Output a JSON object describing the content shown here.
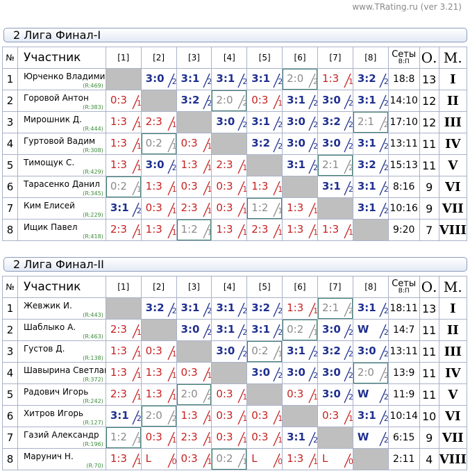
{
  "version": "www.TRating.ru (ver 3.21)",
  "headers": {
    "no": "№",
    "name": "Участник",
    "cols": [
      "[1]",
      "[2]",
      "[3]",
      "[4]",
      "[5]",
      "[6]",
      "[7]",
      "[8]"
    ],
    "sets": "Сеты",
    "sets_sub": "В:П",
    "points": "О.",
    "place": "М."
  },
  "tables": [
    {
      "title": "2 Лига Финал-I",
      "rows": [
        {
          "no": "1",
          "name": "Юрченко Владимир",
          "rating": "(R:469)",
          "results": [
            null,
            [
              "3:0",
              "2",
              "w"
            ],
            [
              "3:1",
              "2",
              "w"
            ],
            [
              "3:1",
              "2",
              "w"
            ],
            [
              "3:1",
              "2",
              "w"
            ],
            [
              "2:0",
              "2",
              "d"
            ],
            [
              "1:3",
              "1",
              "l"
            ],
            [
              "3:2",
              "2",
              "w"
            ]
          ],
          "sets": "18:8",
          "points": "13",
          "place": "I"
        },
        {
          "no": "2",
          "name": "Горовой Антон",
          "rating": "(R:383)",
          "results": [
            [
              "0:3",
              "1",
              "l"
            ],
            null,
            [
              "3:2",
              "2",
              "w"
            ],
            [
              "2:0",
              "2",
              "d"
            ],
            [
              "0:3",
              "1",
              "l"
            ],
            [
              "3:1",
              "2",
              "w"
            ],
            [
              "3:0",
              "2",
              "w"
            ],
            [
              "3:1",
              "2",
              "w"
            ]
          ],
          "sets": "14:10",
          "points": "12",
          "place": "II"
        },
        {
          "no": "3",
          "name": "Мирошник Д.",
          "rating": "(R:444)",
          "results": [
            [
              "1:3",
              "1",
              "l"
            ],
            [
              "2:3",
              "1",
              "l"
            ],
            null,
            [
              "3:0",
              "2",
              "w"
            ],
            [
              "3:1",
              "2",
              "w"
            ],
            [
              "3:0",
              "2",
              "w"
            ],
            [
              "3:2",
              "2",
              "w"
            ],
            [
              "2:1",
              "2",
              "d"
            ]
          ],
          "sets": "17:10",
          "points": "12",
          "place": "III"
        },
        {
          "no": "4",
          "name": "Гуртовой Вадим",
          "rating": "(R:308)",
          "results": [
            [
              "1:3",
              "1",
              "l"
            ],
            [
              "0:2",
              "1",
              "d"
            ],
            [
              "0:3",
              "1",
              "l"
            ],
            null,
            [
              "3:2",
              "2",
              "w"
            ],
            [
              "3:0",
              "2",
              "w"
            ],
            [
              "3:0",
              "2",
              "w"
            ],
            [
              "3:1",
              "2",
              "w"
            ]
          ],
          "sets": "13:11",
          "points": "11",
          "place": "IV"
        },
        {
          "no": "5",
          "name": "Тимощук С.",
          "rating": "(R:429)",
          "results": [
            [
              "1:3",
              "1",
              "l"
            ],
            [
              "3:0",
              "2",
              "w"
            ],
            [
              "1:3",
              "1",
              "l"
            ],
            [
              "2:3",
              "1",
              "l"
            ],
            null,
            [
              "3:1",
              "2",
              "w"
            ],
            [
              "2:1",
              "2",
              "d"
            ],
            [
              "3:2",
              "2",
              "w"
            ]
          ],
          "sets": "15:13",
          "points": "11",
          "place": "V"
        },
        {
          "no": "6",
          "name": "Тарасенко Данил",
          "rating": "(R:345)",
          "results": [
            [
              "0:2",
              "1",
              "d"
            ],
            [
              "1:3",
              "1",
              "l"
            ],
            [
              "0:3",
              "1",
              "l"
            ],
            [
              "0:3",
              "1",
              "l"
            ],
            [
              "1:3",
              "1",
              "l"
            ],
            null,
            [
              "3:1",
              "2",
              "w"
            ],
            [
              "3:1",
              "2",
              "w"
            ]
          ],
          "sets": "8:16",
          "points": "9",
          "place": "VI"
        },
        {
          "no": "7",
          "name": "Ким Елисей",
          "rating": "(R:229)",
          "results": [
            [
              "3:1",
              "2",
              "w"
            ],
            [
              "0:3",
              "1",
              "l"
            ],
            [
              "2:3",
              "1",
              "l"
            ],
            [
              "0:3",
              "1",
              "l"
            ],
            [
              "1:2",
              "1",
              "d"
            ],
            [
              "1:3",
              "1",
              "l"
            ],
            null,
            [
              "3:1",
              "2",
              "w"
            ]
          ],
          "sets": "10:16",
          "points": "9",
          "place": "VII"
        },
        {
          "no": "8",
          "name": "Ищик Павел",
          "rating": "(R:418)",
          "results": [
            [
              "2:3",
              "1",
              "l"
            ],
            [
              "1:3",
              "1",
              "l"
            ],
            [
              "1:2",
              "1",
              "d"
            ],
            [
              "1:3",
              "1",
              "l"
            ],
            [
              "2:3",
              "1",
              "l"
            ],
            [
              "1:3",
              "1",
              "l"
            ],
            [
              "1:3",
              "1",
              "l"
            ],
            null
          ],
          "sets": "9:20",
          "points": "7",
          "place": "VIII"
        }
      ]
    },
    {
      "title": "2 Лига Финал-II",
      "rows": [
        {
          "no": "1",
          "name": "Жевжик И.",
          "rating": "(R:443)",
          "results": [
            null,
            [
              "3:2",
              "2",
              "w"
            ],
            [
              "3:1",
              "2",
              "w"
            ],
            [
              "3:1",
              "2",
              "w"
            ],
            [
              "3:2",
              "2",
              "w"
            ],
            [
              "1:3",
              "1",
              "l"
            ],
            [
              "2:1",
              "2",
              "d"
            ],
            [
              "3:1",
              "2",
              "w"
            ]
          ],
          "sets": "18:11",
          "points": "13",
          "place": "I"
        },
        {
          "no": "2",
          "name": "Шаблыко А.",
          "rating": "(R:463)",
          "results": [
            [
              "2:3",
              "1",
              "l"
            ],
            null,
            [
              "3:0",
              "2",
              "w"
            ],
            [
              "3:1",
              "2",
              "w"
            ],
            [
              "3:1",
              "2",
              "w"
            ],
            [
              "0:2",
              "1",
              "d"
            ],
            [
              "3:0",
              "2",
              "w"
            ],
            [
              "W",
              "2",
              "w"
            ]
          ],
          "sets": "14:7",
          "points": "11",
          "place": "II"
        },
        {
          "no": "3",
          "name": "Густов Д.",
          "rating": "(R:138)",
          "results": [
            [
              "1:3",
              "1",
              "l"
            ],
            [
              "0:3",
              "1",
              "l"
            ],
            null,
            [
              "3:0",
              "2",
              "w"
            ],
            [
              "0:2",
              "1",
              "d"
            ],
            [
              "3:1",
              "2",
              "w"
            ],
            [
              "3:2",
              "2",
              "w"
            ],
            [
              "3:0",
              "2",
              "w"
            ]
          ],
          "sets": "13:11",
          "points": "11",
          "place": "III"
        },
        {
          "no": "4",
          "name": "Шавырина Светлана",
          "rating": "(R:372)",
          "results": [
            [
              "1:3",
              "1",
              "l"
            ],
            [
              "1:3",
              "1",
              "l"
            ],
            [
              "0:3",
              "1",
              "l"
            ],
            null,
            [
              "3:0",
              "2",
              "w"
            ],
            [
              "3:0",
              "2",
              "w"
            ],
            [
              "3:0",
              "2",
              "w"
            ],
            [
              "2:0",
              "2",
              "d"
            ]
          ],
          "sets": "13:9",
          "points": "11",
          "place": "IV"
        },
        {
          "no": "5",
          "name": "Радович Игорь",
          "rating": "(R:242)",
          "results": [
            [
              "2:3",
              "1",
              "l"
            ],
            [
              "1:3",
              "1",
              "l"
            ],
            [
              "2:0",
              "2",
              "d"
            ],
            [
              "0:3",
              "1",
              "l"
            ],
            null,
            [
              "0:3",
              "1",
              "l"
            ],
            [
              "3:0",
              "2",
              "w"
            ],
            [
              "W",
              "2",
              "w"
            ]
          ],
          "sets": "11:9",
          "points": "11",
          "place": "V"
        },
        {
          "no": "6",
          "name": "Хитров Игорь",
          "rating": "(R:127)",
          "results": [
            [
              "3:1",
              "2",
              "w"
            ],
            [
              "2:0",
              "2",
              "d"
            ],
            [
              "1:3",
              "1",
              "l"
            ],
            [
              "0:3",
              "1",
              "l"
            ],
            [
              "0:3",
              "1",
              "l"
            ],
            null,
            [
              "0:3",
              "1",
              "l"
            ],
            [
              "3:1",
              "2",
              "w"
            ]
          ],
          "sets": "10:14",
          "points": "10",
          "place": "VI"
        },
        {
          "no": "7",
          "name": "Газий Александр",
          "rating": "(R:196)",
          "results": [
            [
              "1:2",
              "1",
              "d"
            ],
            [
              "0:3",
              "1",
              "l"
            ],
            [
              "2:3",
              "1",
              "l"
            ],
            [
              "0:3",
              "1",
              "l"
            ],
            [
              "0:3",
              "1",
              "l"
            ],
            [
              "3:1",
              "2",
              "w"
            ],
            null,
            [
              "W",
              "2",
              "w"
            ]
          ],
          "sets": "6:15",
          "points": "9",
          "place": "VII"
        },
        {
          "no": "8",
          "name": "Марунич Н.",
          "rating": "(R:70)",
          "results": [
            [
              "1:3",
              "1",
              "l"
            ],
            [
              "L",
              "0",
              "l"
            ],
            [
              "0:3",
              "1",
              "l"
            ],
            [
              "0:2",
              "1",
              "d"
            ],
            [
              "L",
              "0",
              "l"
            ],
            [
              "1:3",
              "1",
              "l"
            ],
            [
              "L",
              "0",
              "l"
            ],
            null
          ],
          "sets": "2:11",
          "points": "4",
          "place": "VIII"
        }
      ]
    }
  ]
}
